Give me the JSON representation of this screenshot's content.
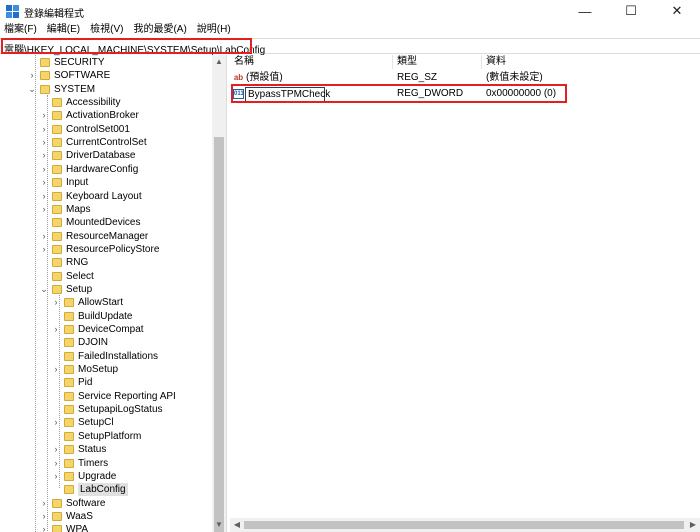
{
  "window": {
    "title": "登錄編輯程式",
    "minimize_glyph": "—",
    "maximize_glyph": "☐",
    "close_glyph": "✕"
  },
  "menu": [
    {
      "label": "檔案(F)"
    },
    {
      "label": "編輯(E)"
    },
    {
      "label": "檢視(V)"
    },
    {
      "label": "我的最愛(A)"
    },
    {
      "label": "說明(H)"
    }
  ],
  "address": {
    "path": "電腦\\HKEY_LOCAL_MACHINE\\SYSTEM\\Setup\\LabConfig"
  },
  "tree": {
    "items": [
      {
        "label": "SECURITY",
        "depth": 1,
        "expander": "none"
      },
      {
        "label": "SOFTWARE",
        "depth": 1,
        "expander": "collapsed"
      },
      {
        "label": "SYSTEM",
        "depth": 1,
        "expander": "expanded"
      },
      {
        "label": "Accessibility",
        "depth": 2,
        "expander": "none"
      },
      {
        "label": "ActivationBroker",
        "depth": 2,
        "expander": "collapsed"
      },
      {
        "label": "ControlSet001",
        "depth": 2,
        "expander": "collapsed"
      },
      {
        "label": "CurrentControlSet",
        "depth": 2,
        "expander": "collapsed"
      },
      {
        "label": "DriverDatabase",
        "depth": 2,
        "expander": "collapsed"
      },
      {
        "label": "HardwareConfig",
        "depth": 2,
        "expander": "collapsed"
      },
      {
        "label": "Input",
        "depth": 2,
        "expander": "collapsed"
      },
      {
        "label": "Keyboard Layout",
        "depth": 2,
        "expander": "collapsed"
      },
      {
        "label": "Maps",
        "depth": 2,
        "expander": "collapsed"
      },
      {
        "label": "MountedDevices",
        "depth": 2,
        "expander": "none"
      },
      {
        "label": "ResourceManager",
        "depth": 2,
        "expander": "collapsed"
      },
      {
        "label": "ResourcePolicyStore",
        "depth": 2,
        "expander": "collapsed"
      },
      {
        "label": "RNG",
        "depth": 2,
        "expander": "none"
      },
      {
        "label": "Select",
        "depth": 2,
        "expander": "none"
      },
      {
        "label": "Setup",
        "depth": 2,
        "expander": "expanded"
      },
      {
        "label": "AllowStart",
        "depth": 3,
        "expander": "collapsed"
      },
      {
        "label": "BuildUpdate",
        "depth": 3,
        "expander": "none"
      },
      {
        "label": "DeviceCompat",
        "depth": 3,
        "expander": "collapsed"
      },
      {
        "label": "DJOIN",
        "depth": 3,
        "expander": "none"
      },
      {
        "label": "FailedInstallations",
        "depth": 3,
        "expander": "none"
      },
      {
        "label": "MoSetup",
        "depth": 3,
        "expander": "collapsed"
      },
      {
        "label": "Pid",
        "depth": 3,
        "expander": "none"
      },
      {
        "label": "Service Reporting API",
        "depth": 3,
        "expander": "none"
      },
      {
        "label": "SetupapiLogStatus",
        "depth": 3,
        "expander": "none"
      },
      {
        "label": "SetupCl",
        "depth": 3,
        "expander": "collapsed"
      },
      {
        "label": "SetupPlatform",
        "depth": 3,
        "expander": "none"
      },
      {
        "label": "Status",
        "depth": 3,
        "expander": "collapsed"
      },
      {
        "label": "Timers",
        "depth": 3,
        "expander": "collapsed"
      },
      {
        "label": "Upgrade",
        "depth": 3,
        "expander": "collapsed"
      },
      {
        "label": "LabConfig",
        "depth": 3,
        "expander": "none",
        "selected": true
      },
      {
        "label": "Software",
        "depth": 2,
        "expander": "collapsed"
      },
      {
        "label": "WaaS",
        "depth": 2,
        "expander": "collapsed"
      },
      {
        "label": "WPA",
        "depth": 2,
        "expander": "collapsed"
      }
    ]
  },
  "list": {
    "columns": {
      "name": "名稱",
      "type": "類型",
      "data": "資料"
    },
    "rows": [
      {
        "icon": "ab",
        "name": "(預設值)",
        "type": "REG_SZ",
        "data": "(數值未設定)"
      },
      {
        "icon": "bin",
        "name": "BypassTPMCheck",
        "type": "REG_DWORD",
        "data": "0x00000000 (0)",
        "editing": true
      }
    ]
  },
  "colors": {
    "highlight_red": "#e51f1f",
    "folder_yellow": "#f4d56a"
  }
}
